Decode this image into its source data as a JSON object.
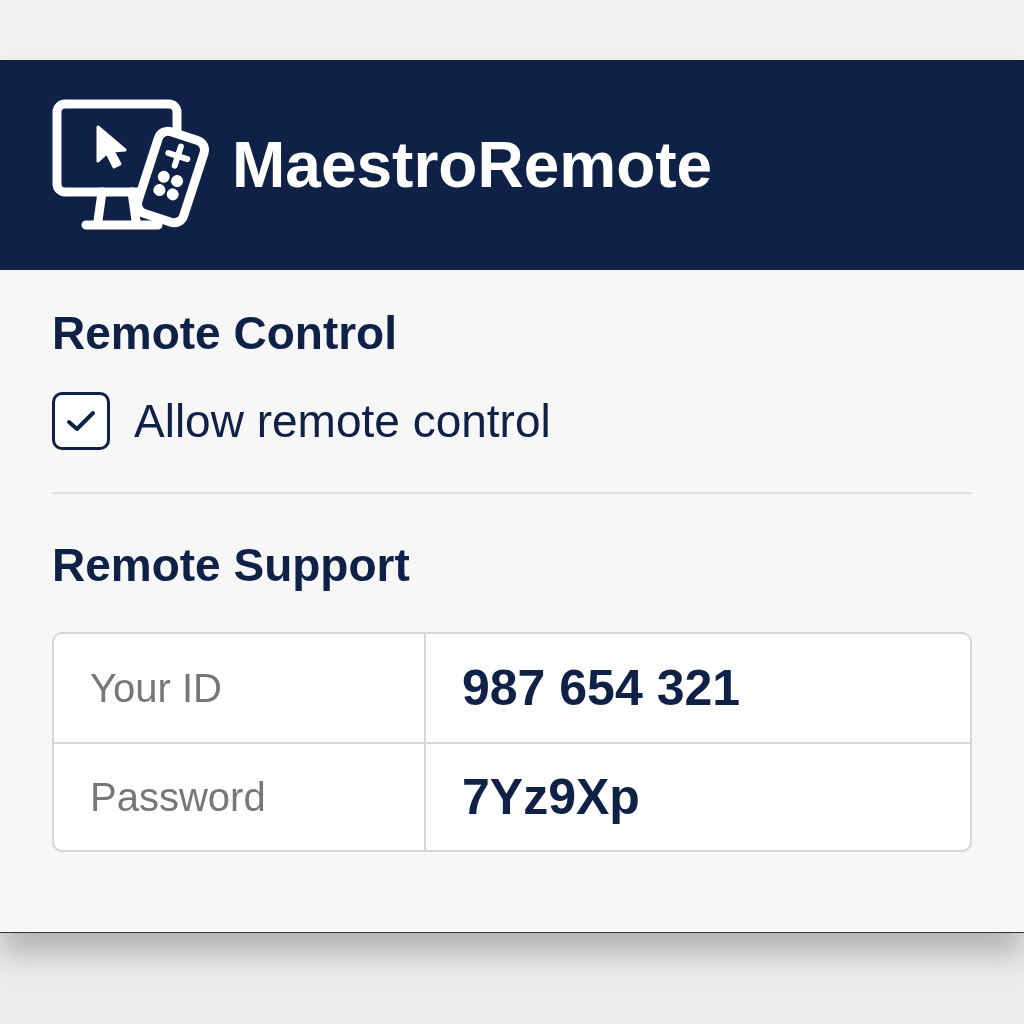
{
  "header": {
    "title": "MaestroRemote"
  },
  "remote_control": {
    "heading": "Remote Control",
    "checkbox": {
      "label": "Allow remote control",
      "checked": true
    }
  },
  "remote_support": {
    "heading": "Remote Support",
    "rows": [
      {
        "label": "Your ID",
        "value": "987 654 321"
      },
      {
        "label": "Password",
        "value": "7Yz9Xp"
      }
    ]
  }
}
